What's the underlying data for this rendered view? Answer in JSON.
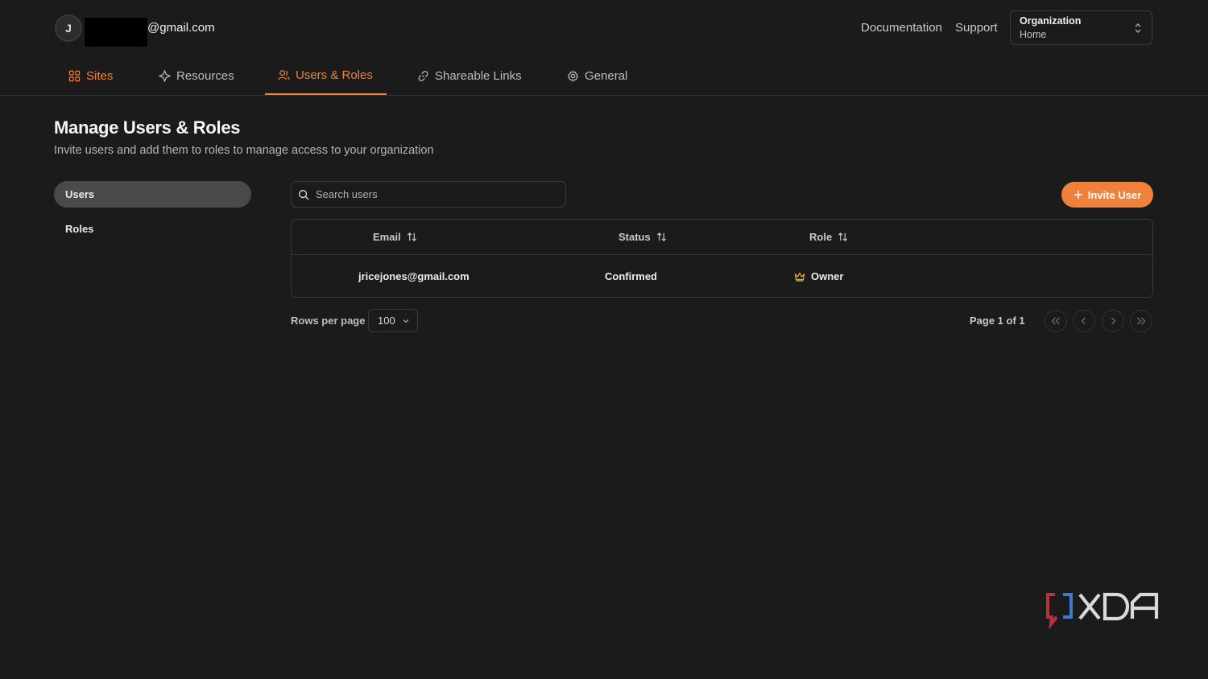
{
  "header": {
    "avatar_initial": "J",
    "email_suffix": "@gmail.com",
    "links": {
      "documentation": "Documentation",
      "support": "Support"
    },
    "org": {
      "label": "Organization",
      "value": "Home"
    }
  },
  "tabs": [
    {
      "label": "Sites",
      "icon": "sites-icon"
    },
    {
      "label": "Resources",
      "icon": "resources-icon"
    },
    {
      "label": "Users & Roles",
      "icon": "users-icon",
      "active": true
    },
    {
      "label": "Shareable Links",
      "icon": "link-icon"
    },
    {
      "label": "General",
      "icon": "gear-icon"
    }
  ],
  "page": {
    "title": "Manage Users & Roles",
    "subtitle": "Invite users and add them to roles to manage access to your organization"
  },
  "sidenav": {
    "users": "Users",
    "roles": "Roles"
  },
  "search": {
    "placeholder": "Search users"
  },
  "invite_label": "Invite User",
  "table": {
    "headers": {
      "email": "Email",
      "status": "Status",
      "role": "Role"
    },
    "rows": [
      {
        "email": "jricejones@gmail.com",
        "status": "Confirmed",
        "role": "Owner"
      }
    ]
  },
  "pagination": {
    "rows_per_page_label": "Rows per page",
    "rows_per_page_value": "100",
    "page_info": "Page 1 of 1"
  },
  "colors": {
    "accent": "#f0813a",
    "background": "#1b1b1b"
  },
  "watermark": "XDA"
}
